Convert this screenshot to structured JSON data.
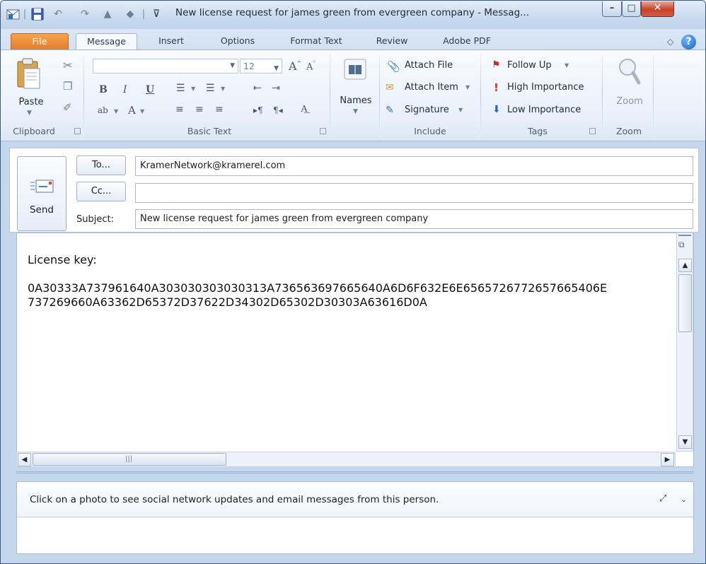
{
  "window": {
    "title": "New license request for james green from evergreen company  - Messag..."
  },
  "tabs": [
    {
      "label": "File"
    },
    {
      "label": "Message"
    },
    {
      "label": "Insert"
    },
    {
      "label": "Options"
    },
    {
      "label": "Format Text"
    },
    {
      "label": "Review"
    },
    {
      "label": "Adobe PDF"
    }
  ],
  "ribbon": {
    "clipboard": {
      "label": "Clipboard",
      "paste": "Paste"
    },
    "basic_text": {
      "label": "Basic Text",
      "font_size": "12"
    },
    "names": {
      "label": "Names"
    },
    "include": {
      "label": "Include",
      "attach_file": "Attach File",
      "attach_item": "Attach Item",
      "signature": "Signature"
    },
    "tags": {
      "label": "Tags",
      "follow_up": "Follow Up",
      "high_importance": "High Importance",
      "low_importance": "Low Importance"
    },
    "zoom": {
      "label": "Zoom",
      "button": "Zoom"
    }
  },
  "compose": {
    "send": "Send",
    "to_button": "To...",
    "cc_button": "Cc...",
    "subject_label": "Subject:",
    "to_value": "KramerNetwork@kramerel.com",
    "cc_value": "",
    "subject_value": "New license request for james green from evergreen company"
  },
  "body": {
    "line1": "License key:",
    "line2": "0A30333A737961640A303030303030313A736563697665640A6D6F632E6E6565726772657665406E",
    "line3": "737269660A63362D65372D37622D34302D65302D30303A63616D0A"
  },
  "people_pane": {
    "message": "Click on a photo to see social network updates and email messages from this person."
  },
  "colors": {
    "file_tab": "#e8792a",
    "accent": "#1d63c6",
    "ribbon_bg": "#e8f0f9",
    "frame": "#c5d7ed"
  }
}
